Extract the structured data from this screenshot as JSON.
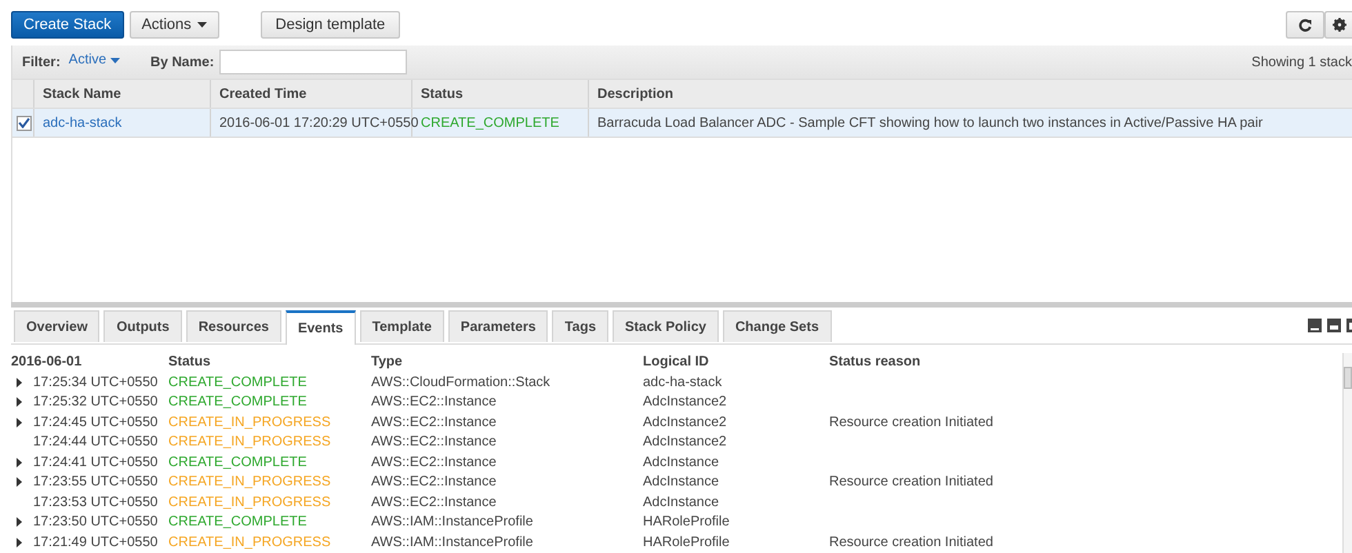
{
  "toolbar": {
    "buttons": [
      {
        "label": "Create Stack",
        "kind": "primary"
      },
      {
        "label": "Actions",
        "kind": "dropdown"
      },
      {
        "label": "Design template",
        "kind": "plain"
      }
    ]
  },
  "filter": {
    "label": "Filter:",
    "value": "Active",
    "name_label": "By Name:",
    "count": "Showing 1 stack"
  },
  "stacks": {
    "columns": [
      "Stack Name",
      "Created Time",
      "Status",
      "Description"
    ],
    "rows": [
      {
        "selected": true,
        "name": "adc-ha-stack",
        "created": "2016-06-01 17:20:29 UTC+0550",
        "status": "CREATE_COMPLETE",
        "color": "#2ea82e",
        "description": "Barracuda Load Balancer ADC - Sample CFT showing how to launch two instances in Active/Passive HA pair"
      }
    ]
  },
  "tabs": [
    {
      "label": "Overview",
      "selected": false
    },
    {
      "label": "Outputs",
      "selected": false
    },
    {
      "label": "Resources",
      "selected": false
    },
    {
      "label": "Events",
      "selected": true
    },
    {
      "label": "Template",
      "selected": false
    },
    {
      "label": "Parameters",
      "selected": false
    },
    {
      "label": "Tags",
      "selected": false
    },
    {
      "label": "Stack Policy",
      "selected": false
    },
    {
      "label": "Change Sets",
      "selected": false
    }
  ],
  "events": {
    "columns": [
      "2016-06-01",
      "Status",
      "Type",
      "Logical ID",
      "Status reason"
    ],
    "rows": [
      {
        "expandable": true,
        "time": "17:25:34 UTC+0550",
        "status": "CREATE_COMPLETE",
        "color": "#2ea82e",
        "type": "AWS::CloudFormation::Stack",
        "logical_id": "adc-ha-stack"
      },
      {
        "expandable": true,
        "time": "17:25:32 UTC+0550",
        "status": "CREATE_COMPLETE",
        "color": "#2ea82e",
        "type": "AWS::EC2::Instance",
        "logical_id": "AdcInstance2"
      },
      {
        "expandable": true,
        "time": "17:24:45 UTC+0550",
        "status": "CREATE_IN_PROGRESS",
        "color": "#f5a623",
        "type": "AWS::EC2::Instance",
        "logical_id": "AdcInstance2",
        "reason": "Resource creation Initiated"
      },
      {
        "expandable": false,
        "time": "17:24:44 UTC+0550",
        "status": "CREATE_IN_PROGRESS",
        "color": "#f5a623",
        "type": "AWS::EC2::Instance",
        "logical_id": "AdcInstance2"
      },
      {
        "expandable": true,
        "time": "17:24:41 UTC+0550",
        "status": "CREATE_COMPLETE",
        "color": "#2ea82e",
        "type": "AWS::EC2::Instance",
        "logical_id": "AdcInstance"
      },
      {
        "expandable": true,
        "time": "17:23:55 UTC+0550",
        "status": "CREATE_IN_PROGRESS",
        "color": "#f5a623",
        "type": "AWS::EC2::Instance",
        "logical_id": "AdcInstance",
        "reason": "Resource creation Initiated"
      },
      {
        "expandable": false,
        "time": "17:23:53 UTC+0550",
        "status": "CREATE_IN_PROGRESS",
        "color": "#f5a623",
        "type": "AWS::EC2::Instance",
        "logical_id": "AdcInstance"
      },
      {
        "expandable": true,
        "time": "17:23:50 UTC+0550",
        "status": "CREATE_COMPLETE",
        "color": "#2ea82e",
        "type": "AWS::IAM::InstanceProfile",
        "logical_id": "HARoleProfile"
      },
      {
        "expandable": true,
        "time": "17:21:49 UTC+0550",
        "status": "CREATE_IN_PROGRESS",
        "color": "#f5a623",
        "type": "AWS::IAM::InstanceProfile",
        "logical_id": "HARoleProfile",
        "reason": "Resource creation Initiated"
      }
    ]
  }
}
